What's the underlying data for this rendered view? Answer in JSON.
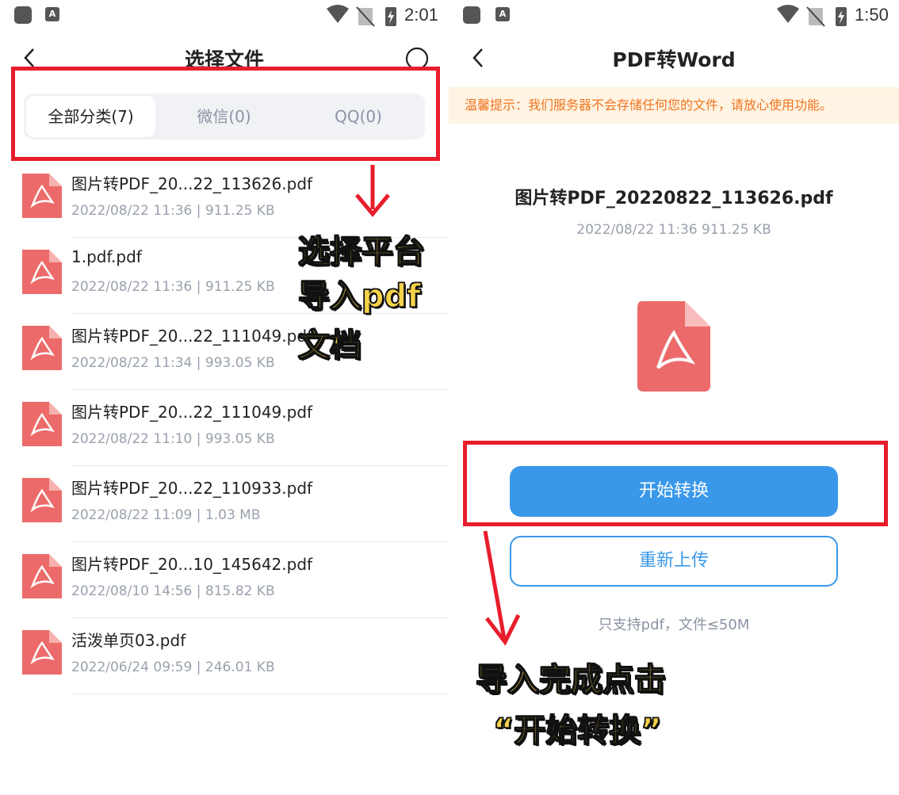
{
  "left": {
    "status_time": "2:01",
    "title": "选择文件",
    "tabs": [
      {
        "label": "全部分类(7)",
        "active": true
      },
      {
        "label": "微信(0)",
        "active": false
      },
      {
        "label": "QQ(0)",
        "active": false
      }
    ],
    "files": [
      {
        "name": "图片转PDF_20...22_113626.pdf",
        "meta": "2022/08/22 11:36 |  911.25 KB"
      },
      {
        "name": "1.pdf.pdf",
        "meta": "2022/08/22 11:36 |  911.25 KB"
      },
      {
        "name": "图片转PDF_20...22_111049.pdf",
        "meta": "2022/08/22 11:34 |  993.05 KB"
      },
      {
        "name": "图片转PDF_20...22_111049.pdf",
        "meta": "2022/08/22 11:10 |  993.05 KB"
      },
      {
        "name": "图片转PDF_20...22_110933.pdf",
        "meta": "2022/08/22 11:09 |  1.03 MB"
      },
      {
        "name": "图片转PDF_20...10_145642.pdf",
        "meta": "2022/08/10 14:56 |  815.82 KB"
      },
      {
        "name": "活泼单页03.pdf",
        "meta": "2022/06/24 09:59 |  246.01 KB"
      }
    ],
    "annotation_lines": [
      "选择平台",
      "导入pdf",
      "文档"
    ]
  },
  "right": {
    "status_time": "1:50",
    "title": "PDF转Word",
    "notice": "温馨提示：我们服务器不会存储任何您的文件，请放心使用功能。",
    "file_name": "图片转PDF_20220822_113626.pdf",
    "file_meta": "2022/08/22 11:36  911.25 KB",
    "start_button": "开始转换",
    "reupload_button": "重新上传",
    "support_text": "只支持pdf，文件≤50M",
    "annotation_lines": [
      "导入完成点击",
      "“开始转换”"
    ]
  },
  "colors": {
    "accent_blue": "#3a98ea",
    "annotation_red": "#e81d2c",
    "annotation_yellow": "#f6d24a",
    "pdf_icon_red": "#ec6b6a",
    "notice_text": "#f0731e",
    "notice_bg": "#fff4e3"
  },
  "icons": [
    "back-chevron-icon",
    "circle-select-icon",
    "pdf-file-icon",
    "wifi-icon",
    "no-sim-icon",
    "battery-charging-icon"
  ]
}
